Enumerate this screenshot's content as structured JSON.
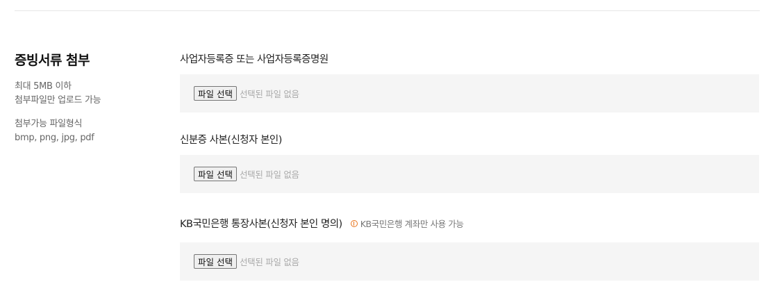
{
  "sidebar": {
    "title": "증빙서류 첨부",
    "size_limit": [
      "최대 5MB 이하",
      "첨부파일만 업로드 가능"
    ],
    "formats": [
      "첨부가능 파일형식",
      "bmp, png, jpg, pdf"
    ]
  },
  "fields": [
    {
      "label": "사업자등록증 또는 사업자등록증명원",
      "button": "파일 선택",
      "status": "선택된 파일 없음"
    },
    {
      "label": "신분증 사본(신청자 본인)",
      "button": "파일 선택",
      "status": "선택된 파일 없음"
    },
    {
      "label": "KB국민은행 통장사본(신청자 본인 명의)",
      "notice": "KB국민은행 계좌만 사용 가능",
      "notice_icon": "info-circle-icon",
      "notice_color": "#e8741d",
      "button": "파일 선택",
      "status": "선택된 파일 없음"
    }
  ]
}
